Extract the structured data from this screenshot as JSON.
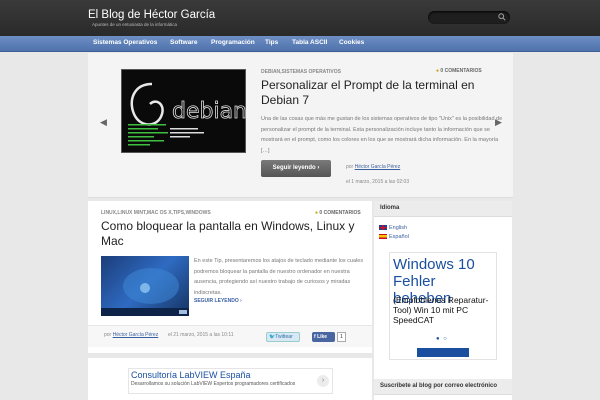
{
  "header": {
    "brand": "El Blog de Héctor García",
    "tagline": "Apuntes de un entusiasta de la informática"
  },
  "nav": {
    "items": [
      "Sistemas Operativos",
      "Software",
      "Programación",
      "Tips",
      "Tabla ASCII",
      "Cookies"
    ]
  },
  "slider": {
    "categories": "DEBIAN,SISTEMAS OPERATIVOS",
    "comments": "0 COMENTARIOS",
    "title": "Personalizar el Prompt de la terminal en Debian 7",
    "excerpt": "Una de las cosas que más me gustan de los sistemas operativos de tipo \"Unix\" es la posibilidad de personalizar el prompt de la terminal. Esta personalización incluye tanto la información que se mostrará en el prompt, como los colores en los que se mostrará dicha información. En la mayoría […]",
    "button_label": "Seguir leyendo",
    "by_prefix": "por",
    "author": "Héctor García Pérez",
    "date": "el 1 marzo, 2015 a las 02:03",
    "thumb_logo": "debian"
  },
  "post": {
    "categories": "LINUX,LINUX MINT,MAC OS X,TIPS,WINDOWS",
    "comments": "0 COMENTARIOS",
    "title": "Como bloquear la pantalla en Windows, Linux y Mac",
    "excerpt": "En este Tip, presentaremos los atajos de teclado mediante los cuales podremos bloquear la pantalla de nuestro ordenador en nuestra ausencia, protegiendo así nuestro trabajo de curiosos y miradas indiscretas.",
    "read_more": "SEGUIR LEYENDO",
    "by_prefix": "por",
    "author": "Héctor García Pérez",
    "date": "el 21 marzo, 2015 a las 10:11",
    "twitter_label": "Twittear",
    "like_label": "Like",
    "like_count": "1"
  },
  "ads": {
    "bottom_title": "Consultoría LabVIEW España",
    "bottom_sub": "Desarrollamos su solución LabVIEW Expertos programadores certificados",
    "sidebar_title": "Windows 10 Fehler beheben",
    "sidebar_sub": "(Empfohlenes Reparatur-Tool) Win 10 mit PC SpeedCAT"
  },
  "sidebar": {
    "idioma_heading": "Idioma",
    "languages": [
      "English",
      "Español"
    ],
    "subscribe_heading": "Suscríbete al blog por correo electrónico"
  },
  "colors": {
    "nav": "#5a7cb6",
    "accent": "#c8a200",
    "link": "#3a5fa0"
  }
}
